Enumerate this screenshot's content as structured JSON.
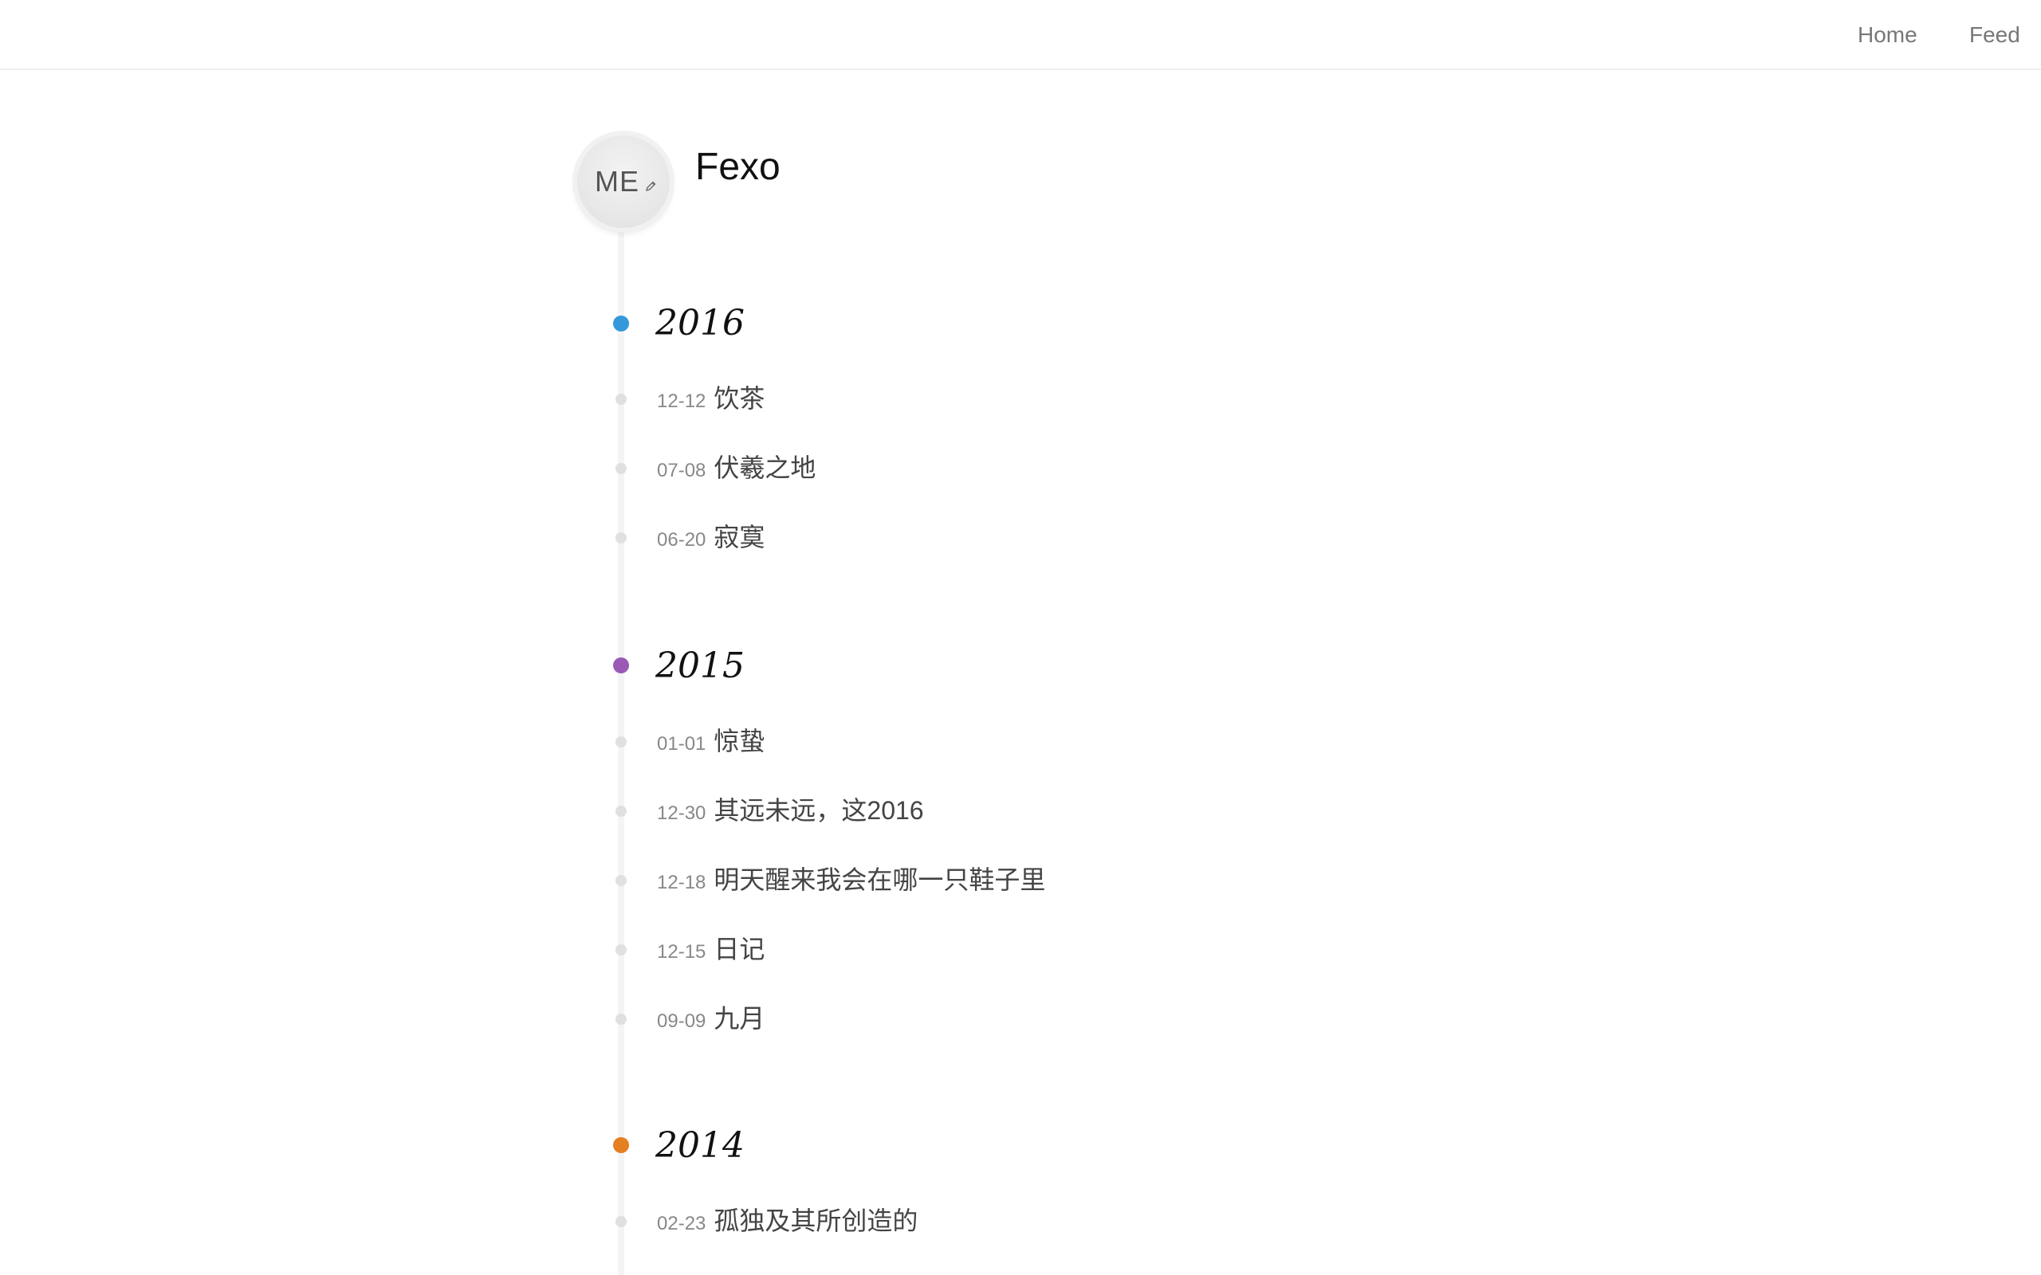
{
  "nav": {
    "home_label": "Home",
    "feed_label": "Feed"
  },
  "profile": {
    "avatar_text": "ME",
    "name": "Fexo"
  },
  "years": [
    {
      "year": "2016",
      "color": "#3498db",
      "posts": [
        {
          "date": "12-12",
          "title": "饮茶"
        },
        {
          "date": "07-08",
          "title": "伏羲之地"
        },
        {
          "date": "06-20",
          "title": "寂寞"
        }
      ]
    },
    {
      "year": "2015",
      "color": "#9b59b6",
      "posts": [
        {
          "date": "01-01",
          "title": "惊蛰"
        },
        {
          "date": "12-30",
          "title": "其远未远，这2016"
        },
        {
          "date": "12-18",
          "title": "明天醒来我会在哪一只鞋子里"
        },
        {
          "date": "12-15",
          "title": "日记"
        },
        {
          "date": "09-09",
          "title": "九月"
        }
      ]
    },
    {
      "year": "2014",
      "color": "#e67e22",
      "posts": [
        {
          "date": "02-23",
          "title": "孤独及其所创造的"
        }
      ]
    }
  ]
}
